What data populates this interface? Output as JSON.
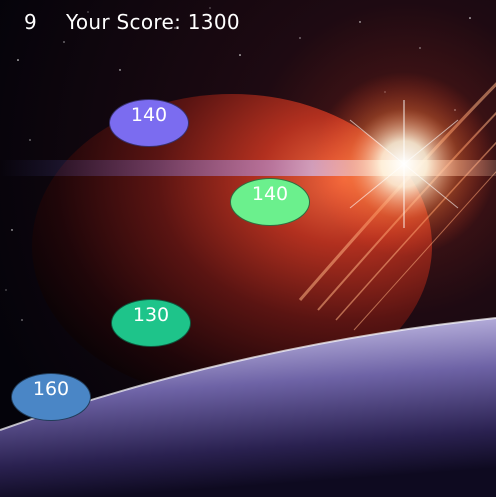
{
  "hud": {
    "timer": "9",
    "score_text": "Your Score: 1300"
  },
  "bubbles": [
    {
      "value": "140",
      "color": "#7b6cf0"
    },
    {
      "value": "140",
      "color": "#6bf08d"
    },
    {
      "value": "130",
      "color": "#1ec48a"
    },
    {
      "value": "160",
      "color": "#4a86c6"
    }
  ],
  "theme": {
    "sky": "#05030a",
    "planet_glow": "#e0422a",
    "sun_flare": "#fff6ec",
    "surface": "#c9c4e6"
  }
}
